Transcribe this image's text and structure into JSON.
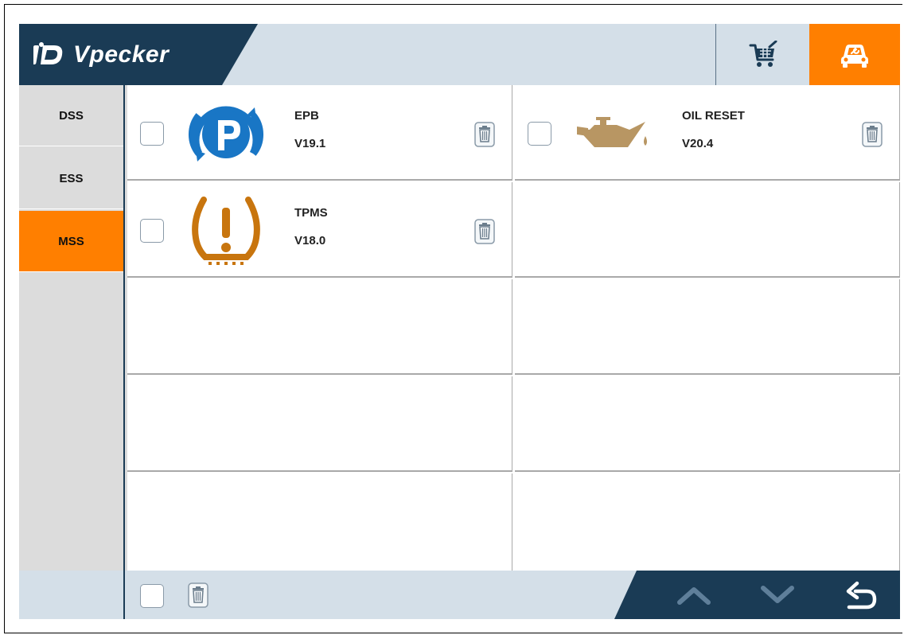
{
  "app": {
    "brand_name": "Vpecker",
    "brand_mark": "iD"
  },
  "header": {
    "cart_icon": "cart-icon",
    "service_icon": "car-service-icon",
    "colors": {
      "navy": "#1a3b55",
      "orange": "#ff7f00",
      "light": "#d4dfe8"
    }
  },
  "sidebar": {
    "tabs": [
      {
        "label": "DSS",
        "active": false
      },
      {
        "label": "ESS",
        "active": false
      },
      {
        "label": "MSS",
        "active": true
      }
    ]
  },
  "functions": [
    {
      "name": "EPB",
      "version": "V19.1",
      "icon": "parking-brake-icon"
    },
    {
      "name": "OIL RESET",
      "version": "V20.4",
      "icon": "oil-can-icon"
    },
    {
      "name": "TPMS",
      "version": "V18.0",
      "icon": "tire-pressure-icon"
    }
  ],
  "footer": {
    "icons": [
      "select-all-checkbox",
      "trash-icon",
      "chevron-up-icon",
      "chevron-down-icon",
      "back-icon"
    ]
  }
}
